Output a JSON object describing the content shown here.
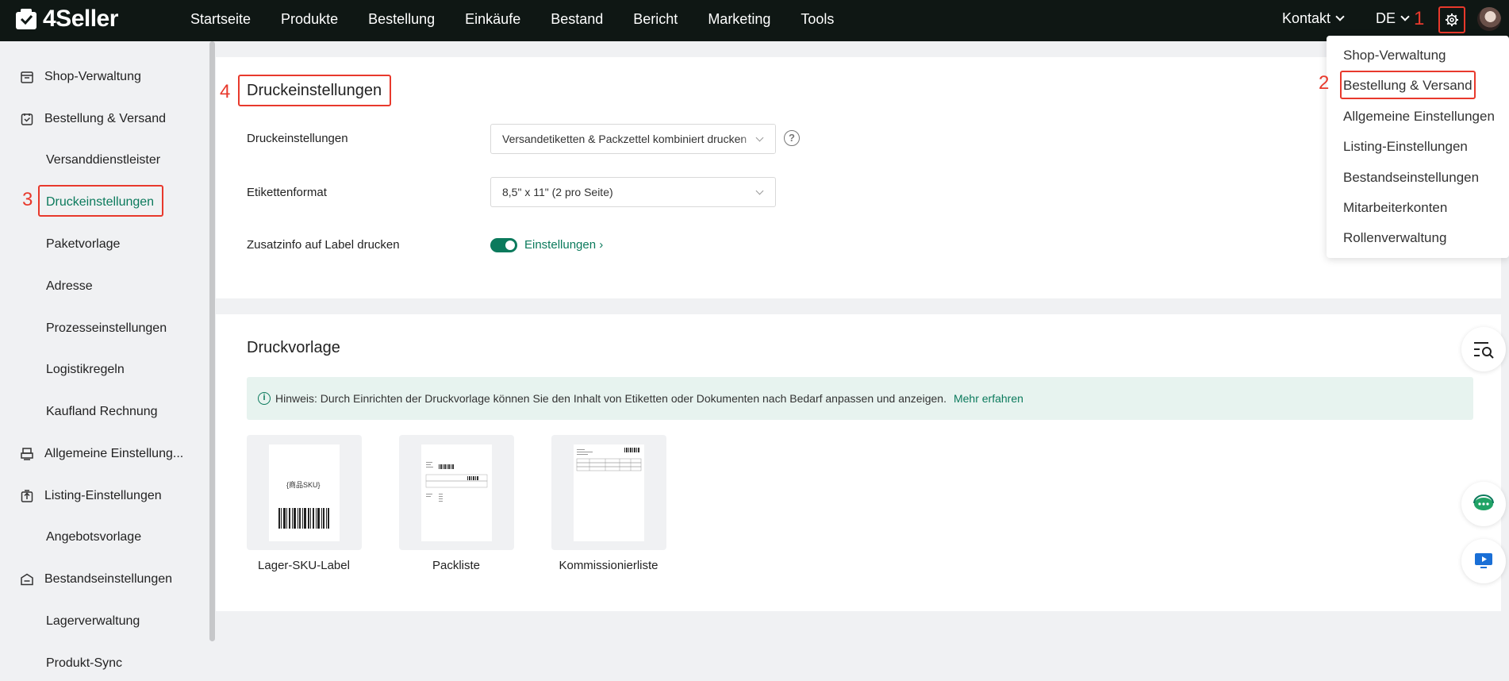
{
  "brand": {
    "name": "4Seller",
    "accent": "#0b7a5c",
    "highlight": "#e8392c"
  },
  "nav": {
    "items": [
      "Startseite",
      "Produkte",
      "Bestellung",
      "Einkäufe",
      "Bestand",
      "Bericht",
      "Marketing",
      "Tools"
    ],
    "kontakt": "Kontakt",
    "language": "DE"
  },
  "annotations": {
    "a1": "1",
    "a2": "2",
    "a3": "3",
    "a4": "4"
  },
  "sidebar": {
    "items": [
      {
        "label": "Shop-Verwaltung",
        "type": "group",
        "icon": "shop-icon"
      },
      {
        "label": "Bestellung & Versand",
        "type": "group",
        "icon": "order-icon"
      },
      {
        "label": "Versanddienstleister",
        "type": "sub"
      },
      {
        "label": "Druckeinstellungen",
        "type": "sub",
        "active": true
      },
      {
        "label": "Paketvorlage",
        "type": "sub"
      },
      {
        "label": "Adresse",
        "type": "sub"
      },
      {
        "label": "Prozesseinstellungen",
        "type": "sub"
      },
      {
        "label": "Logistikregeln",
        "type": "sub"
      },
      {
        "label": "Kaufland Rechnung",
        "type": "sub"
      },
      {
        "label": "Allgemeine Einstellung...",
        "type": "group",
        "icon": "printer-icon"
      },
      {
        "label": "Listing-Einstellungen",
        "type": "group",
        "icon": "upload-icon"
      },
      {
        "label": "Angebotsvorlage",
        "type": "sub"
      },
      {
        "label": "Bestandseinstellungen",
        "type": "group",
        "icon": "warehouse-icon"
      },
      {
        "label": "Lagerverwaltung",
        "type": "sub"
      },
      {
        "label": "Produkt-Sync",
        "type": "sub"
      }
    ]
  },
  "print_settings": {
    "title": "Druckeinstellungen",
    "fields": {
      "print_label": "Druckeinstellungen",
      "print_value": "Versandetiketten & Packzettel kombiniert drucken",
      "format_label": "Etikettenformat",
      "format_value": "8,5\" x 11\" (2 pro Seite)",
      "extra_label": "Zusatzinfo auf Label drucken",
      "extra_enabled": true,
      "extra_link": "Einstellungen"
    }
  },
  "print_templates": {
    "title": "Druckvorlage",
    "notice": "Hinweis: Durch Einrichten der Druckvorlage können Sie den Inhalt von Etiketten oder Dokumenten nach Bedarf anpassen und anzeigen.",
    "notice_link": "Mehr erfahren",
    "templates": [
      {
        "label": "Lager-SKU-Label",
        "thumb_text": "{商品SKU}"
      },
      {
        "label": "Packliste"
      },
      {
        "label": "Kommissionierliste"
      }
    ]
  },
  "settings_menu": {
    "items": [
      "Shop-Verwaltung",
      "Bestellung & Versand",
      "Allgemeine Einstellungen",
      "Listing-Einstellungen",
      "Bestandseinstellungen",
      "Mitarbeiterkonten",
      "Rollenverwaltung"
    ]
  }
}
